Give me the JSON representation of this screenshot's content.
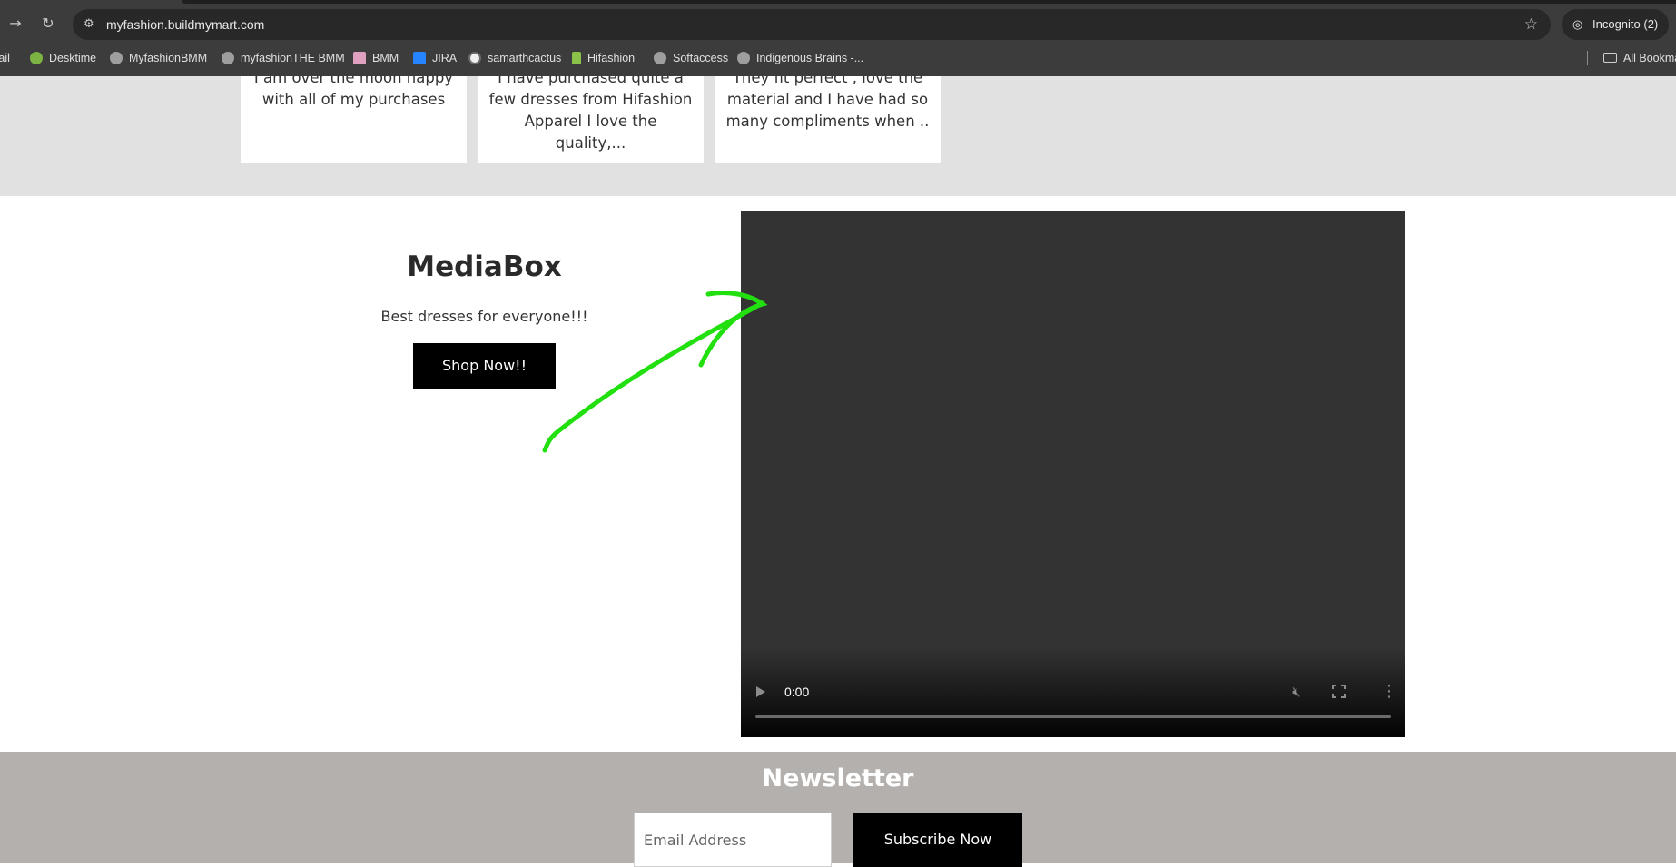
{
  "browser": {
    "url": "myfashion.buildmymart.com",
    "incognito_label": "Incognito (2)",
    "bookmarks": [
      {
        "label": "Mail",
        "favicon_color": "#ea4335"
      },
      {
        "label": "Desktime",
        "favicon_color": "#7cb342"
      },
      {
        "label": "MyfashionBMM",
        "favicon_color": "#bdbdbd"
      },
      {
        "label": "myfashionTHE BMM",
        "favicon_color": "#bdbdbd"
      },
      {
        "label": "BMM",
        "favicon_color": "#e0a0c0"
      },
      {
        "label": "JIRA",
        "favicon_color": "#2684ff"
      },
      {
        "label": "samarthcactus",
        "favicon_color": "#f0f0f0"
      },
      {
        "label": "Hifashion",
        "favicon_color": "#8bc34a"
      },
      {
        "label": "Softaccess",
        "favicon_color": "#bdbdbd"
      },
      {
        "label": "Indigenous Brains -...",
        "favicon_color": "#bdbdbd"
      }
    ],
    "all_bookmarks_label": "All Bookma"
  },
  "testimonials": [
    {
      "line1": "I am over the moon happy",
      "line2": "with all of my purchases",
      "line3": ""
    },
    {
      "line1": "I have purchased quite a",
      "line2": "few dresses from Hifashion",
      "line3": "Apparel I love the quality,..."
    },
    {
      "line1": "They fit perfect , love the",
      "line2": "material and I have had so",
      "line3": "many compliments when .."
    }
  ],
  "mediabox": {
    "title": "MediaBox",
    "subtitle": "Best dresses for everyone!!!",
    "button_label": "Shop Now!!"
  },
  "video": {
    "time": "0:00",
    "progress": 0
  },
  "newsletter": {
    "title": "Newsletter",
    "email_placeholder": "Email Address",
    "button_label": "Subscribe Now"
  },
  "colors": {
    "annotation_arrow": "#22e010",
    "testimonial_bg": "#e1e1e1",
    "newsletter_bg": "#b4b0ae"
  }
}
